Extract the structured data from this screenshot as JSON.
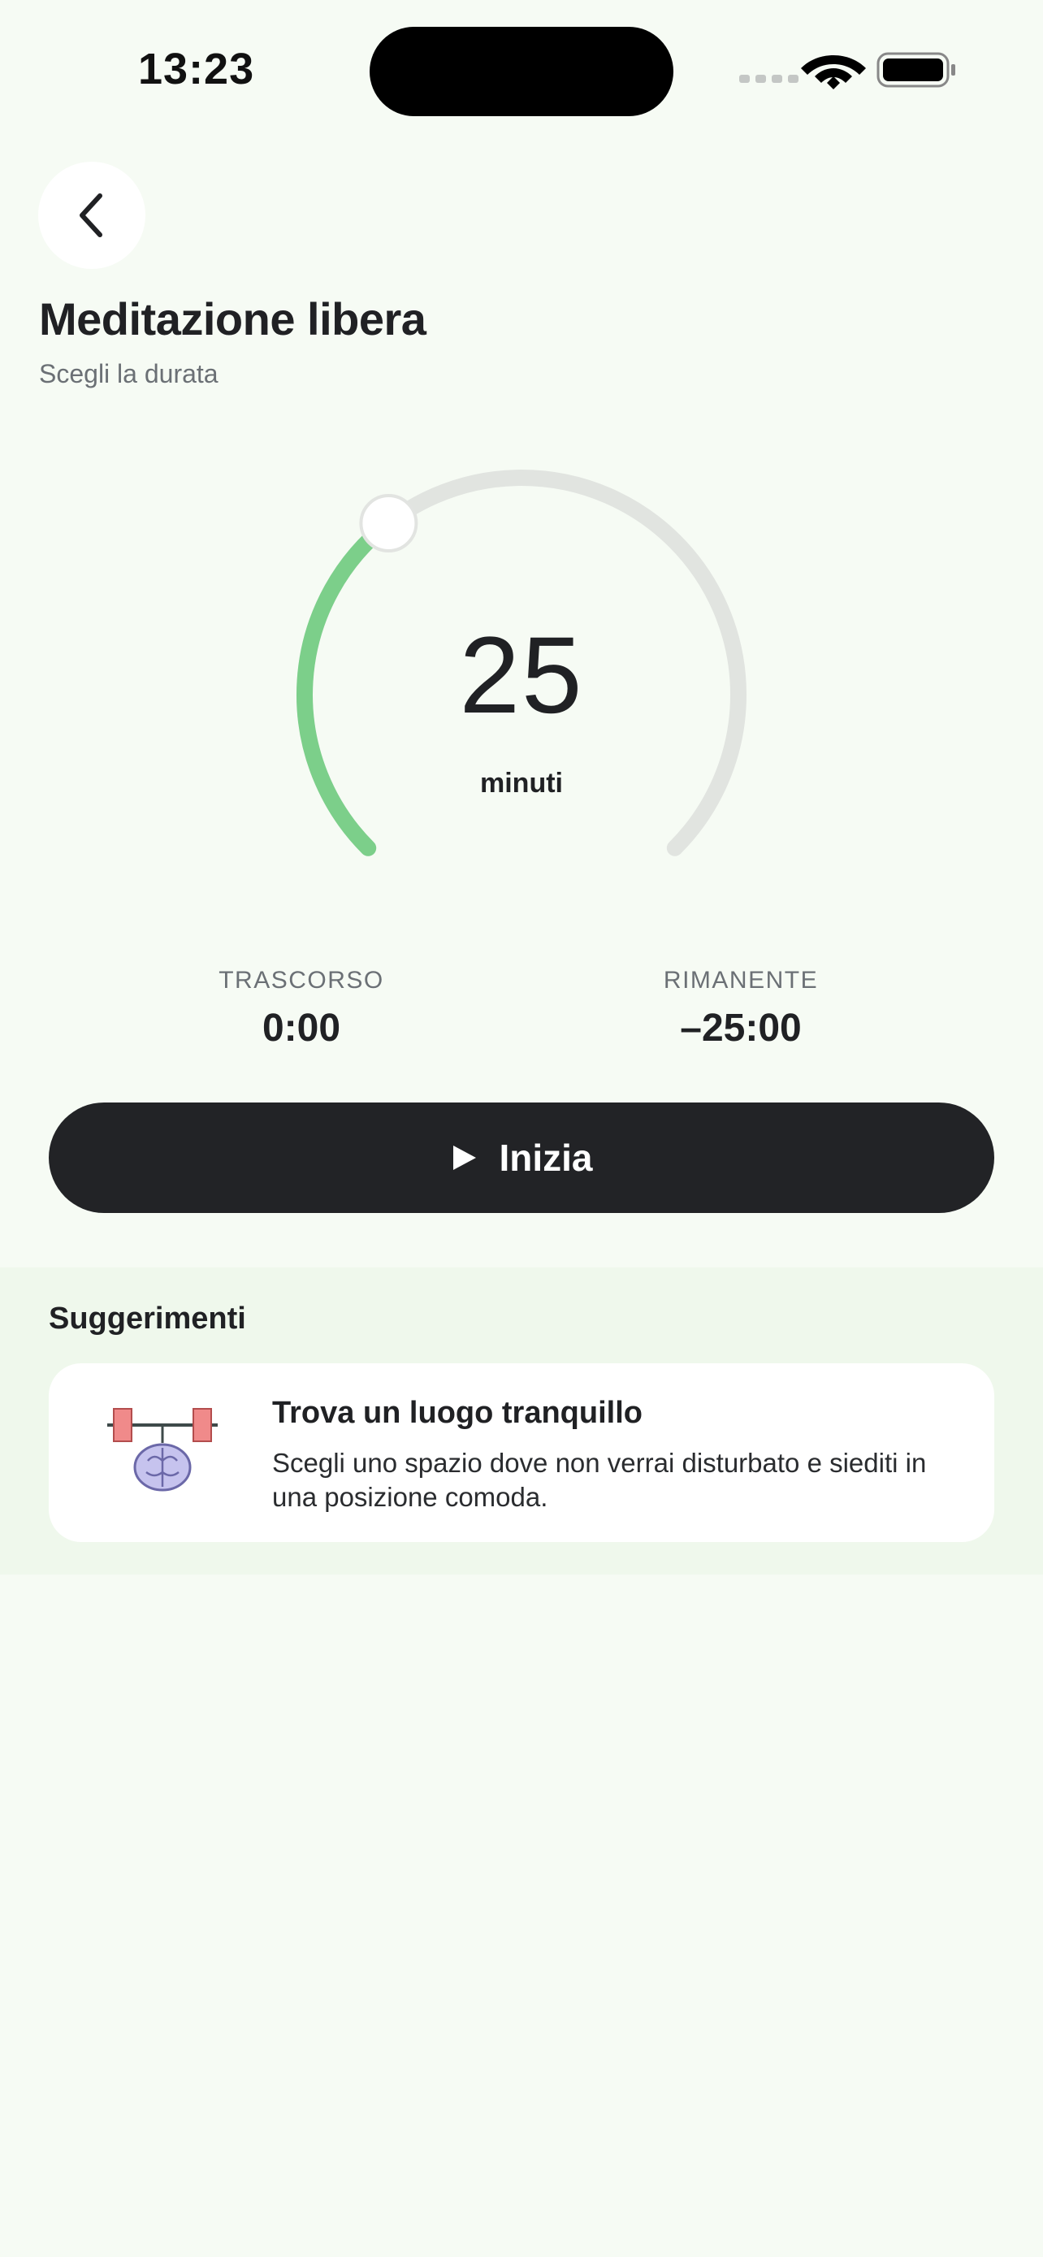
{
  "status_bar": {
    "time": "13:23"
  },
  "header": {
    "title": "Meditazione libera",
    "subtitle": "Scegli la durata"
  },
  "dial": {
    "value": "25",
    "unit": "minuti",
    "progress_fraction": 0.36,
    "colors": {
      "track": "#e1e4e0",
      "progress": "#7ccf8a",
      "knob": "#ffffff"
    }
  },
  "stats": {
    "elapsed_label": "TRASCORSO",
    "elapsed_value": "0:00",
    "remaining_label": "RIMANENTE",
    "remaining_value": "–25:00"
  },
  "start_button": {
    "label": "Inizia",
    "icon": "play-icon"
  },
  "suggestions": {
    "title": "Suggerimenti",
    "items": [
      {
        "title": "Trova un luogo tranquillo",
        "text": "Scegli uno spazio dove non verrai disturbato e siediti in una posizione comoda.",
        "icon": "brain-barbell-icon"
      }
    ]
  },
  "colors": {
    "background": "#f6fbf4",
    "button": "#222326",
    "accent": "#7ccf8a"
  }
}
